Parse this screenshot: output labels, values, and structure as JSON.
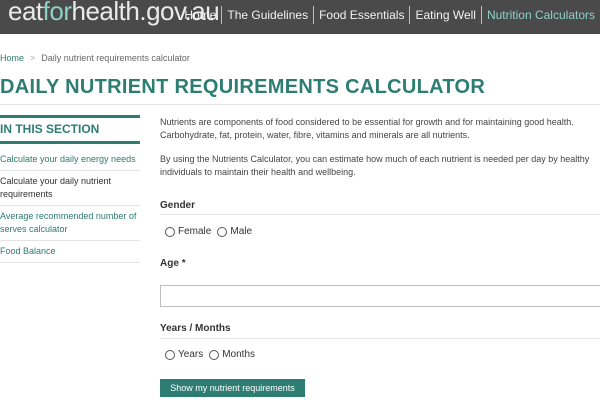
{
  "header": {
    "logo_prefix": "eat",
    "logo_accent": "for",
    "logo_suffix": "health.gov.au",
    "nav": [
      "Home",
      "The Guidelines",
      "Food Essentials",
      "Eating Well",
      "Nutrition Calculators"
    ],
    "current_nav": "Nutrition Calculators",
    "bg_color": "#4a4a4a",
    "accent_color": "#8cd0c6"
  },
  "breadcrumb": {
    "home": "Home",
    "separator": ">",
    "current": "Daily nutrient requirements calculator"
  },
  "page_title": "DAILY NUTRIENT REQUIREMENTS CALCULATOR",
  "sidebar": {
    "heading": "IN THIS SECTION",
    "items": [
      {
        "label": "Calculate your daily energy needs"
      },
      {
        "label": "Calculate your daily nutrient requirements"
      },
      {
        "label": "Average recommended number of serves calculator"
      },
      {
        "label": "Food Balance"
      }
    ],
    "active_index": 1
  },
  "main": {
    "intro_1_line_1": "Nutrients are components of food considered to be essential for growth and for maintaining good health.",
    "intro_1_line_2": "Carbohydrate, fat, protein, water, fibre, vitamins and minerals are all nutrients.",
    "intro_2_line_1": "By using the Nutrients Calculator, you can estimate how much of each nutrient is needed per day by healthy",
    "intro_2_line_2": "individuals to maintain their health and wellbeing.",
    "gender": {
      "label": "Gender",
      "options": [
        "Female",
        "Male"
      ]
    },
    "age": {
      "label": "Age",
      "required_marker": "*",
      "value": ""
    },
    "years_months": {
      "label": "Years / Months",
      "options": [
        "Years",
        "Months"
      ]
    },
    "submit_label": "Show my nutrient requirements"
  },
  "theme": {
    "primary_green": "#2e7d73"
  }
}
